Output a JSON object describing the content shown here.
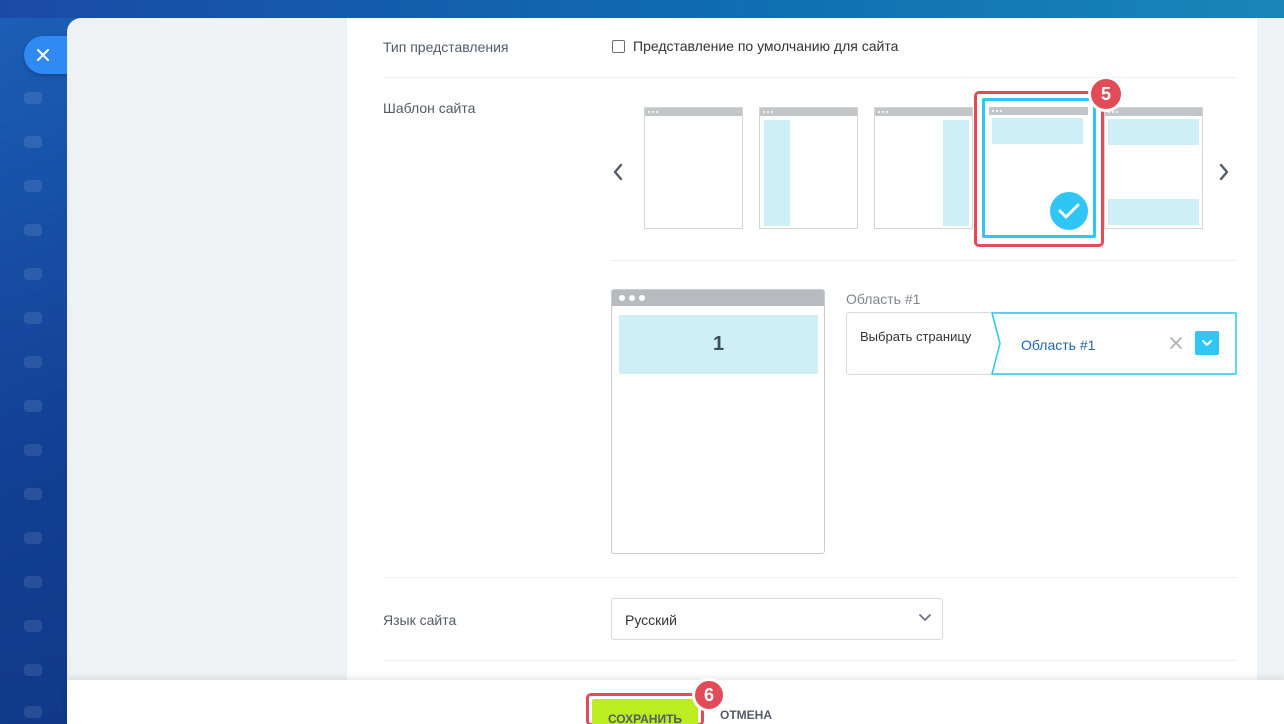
{
  "colors": {
    "accent_blue": "#2fc6f6",
    "highlight_red": "#e24c58",
    "save_green": "#bbed21",
    "close_blue": "#2f8bf3"
  },
  "window": {
    "close_icon": "close-icon"
  },
  "view_type": {
    "label": "Тип представления",
    "default_checkbox_label": "Представление по умолчанию для сайта",
    "default_checked": false
  },
  "site_template": {
    "label": "Шаблон сайта",
    "selected_index": 3,
    "prev_icon": "chevron-left-icon",
    "next_icon": "chevron-right-icon",
    "templates": [
      "empty",
      "left-sidebar",
      "right-sidebar",
      "header",
      "header-footer"
    ]
  },
  "step_badges": {
    "template": "5",
    "save": "6"
  },
  "area": {
    "preview_number": "1",
    "title": "Область #1",
    "left_label": "Выбрать страницу",
    "value": "Область #1"
  },
  "language": {
    "label": "Язык сайта",
    "value": "Русский"
  },
  "footer": {
    "save_label": "СОХРАНИТЬ",
    "cancel_label": "ОТМЕНА"
  }
}
